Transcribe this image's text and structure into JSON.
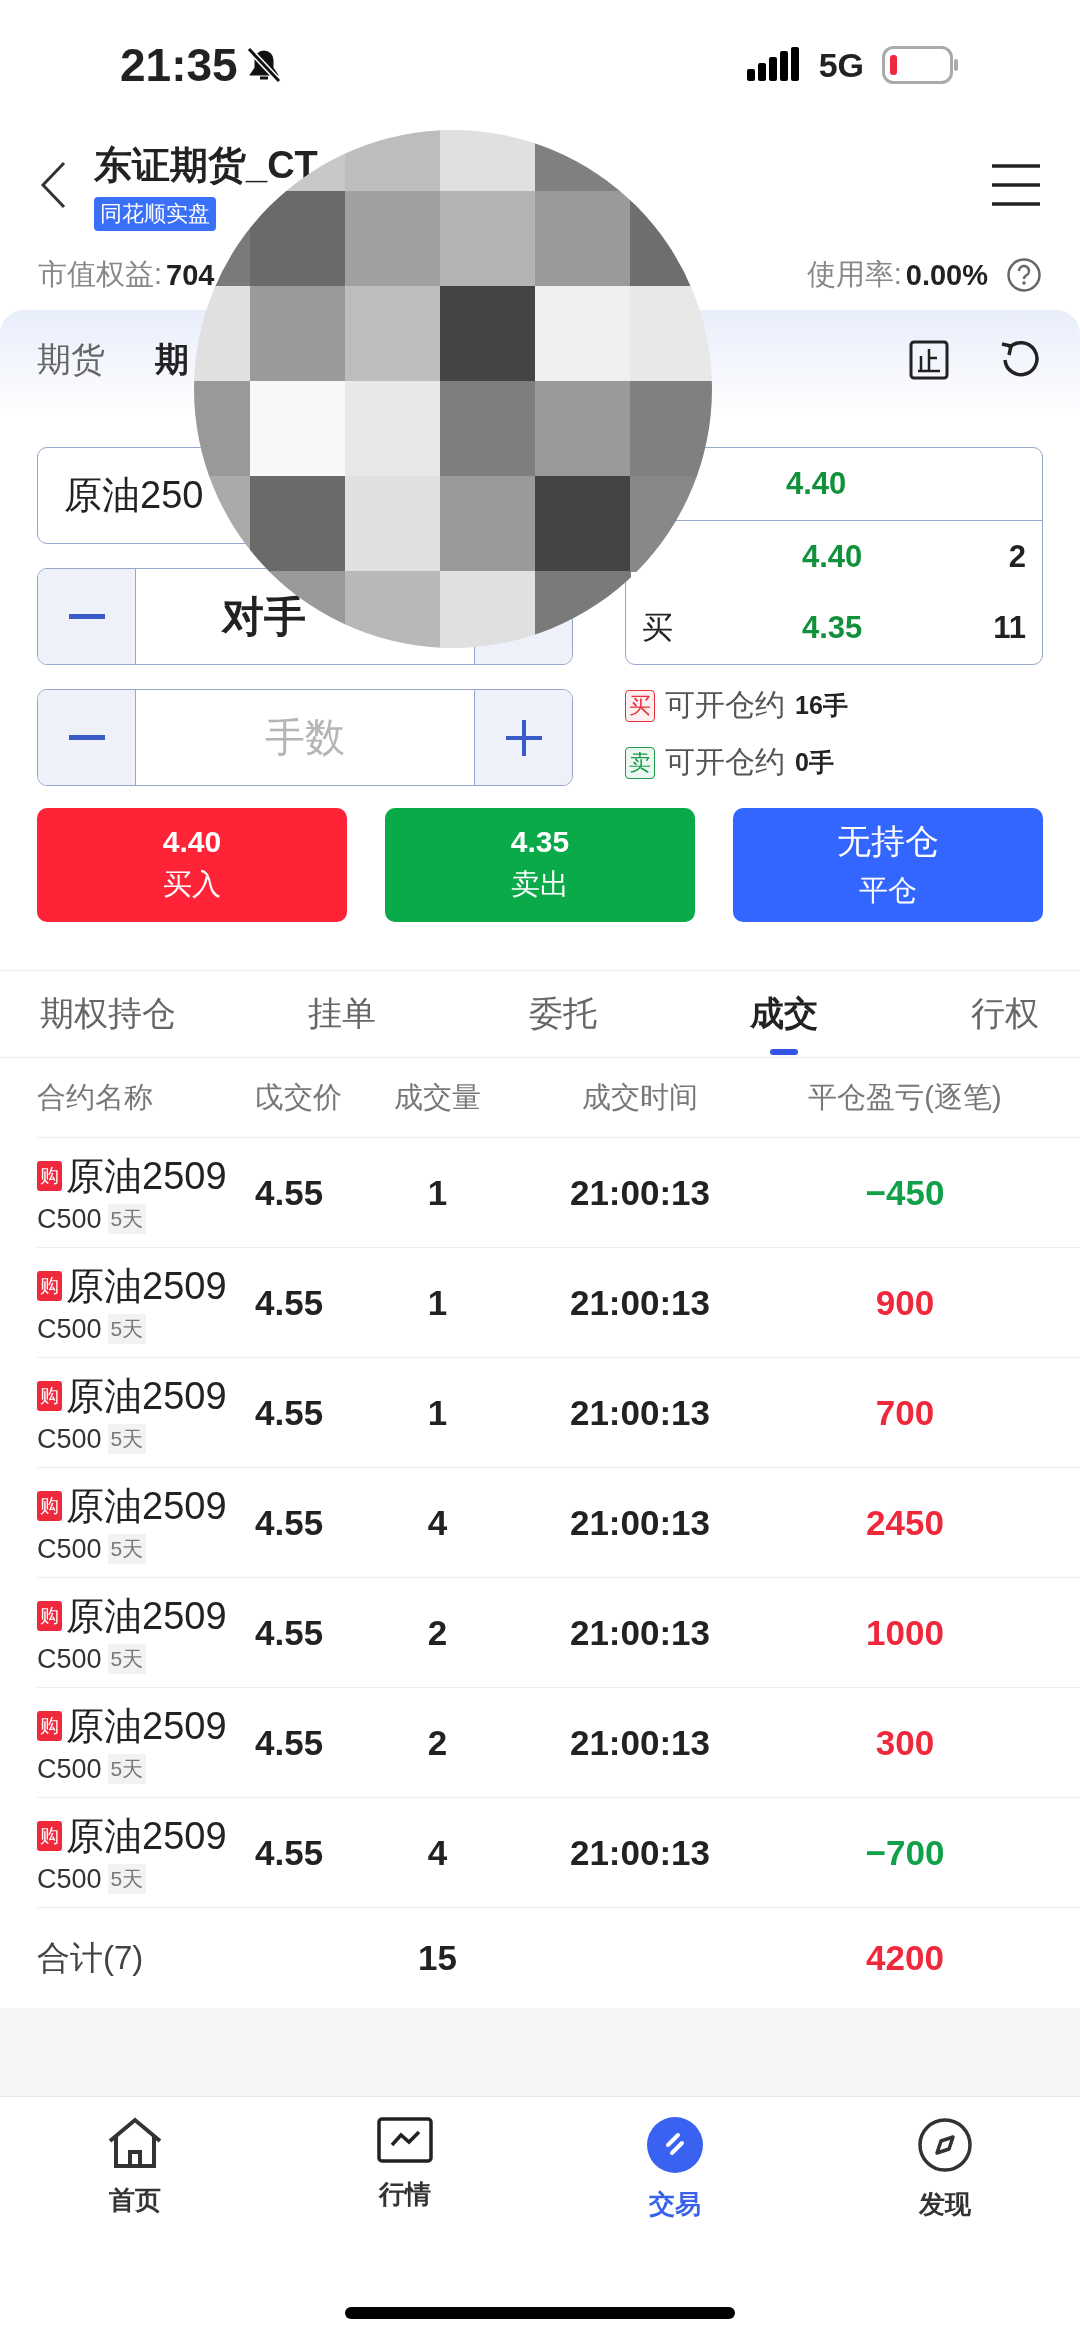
{
  "status_bar": {
    "time": "21:35",
    "network": "5G"
  },
  "header": {
    "title": "东证期货_CT",
    "badge": "同花顺实盘"
  },
  "account": {
    "equity_label": "市值权益:",
    "equity_value": "704",
    "usage_label": "使用率:",
    "usage_value": "0.00%"
  },
  "mode_tabs": [
    {
      "label": "期货",
      "selected": false
    },
    {
      "label": "期",
      "selected": true
    }
  ],
  "order_form": {
    "contract": "原油250",
    "steppers": [
      {
        "value": "对手"
      },
      {
        "placeholder": "手数"
      }
    ],
    "quote": {
      "last": "4.40",
      "rows": [
        {
          "price": "4.40",
          "qty": "2"
        },
        {
          "side": "买",
          "price": "4.35",
          "qty": "11"
        }
      ]
    },
    "availability": [
      {
        "side": "买",
        "label": "可开仓约",
        "amount": "16手",
        "color": "#e8303f"
      },
      {
        "side": "卖",
        "label": "可开仓约",
        "amount": "0手",
        "color": "#1a9a48"
      }
    ],
    "actions": [
      {
        "kind": "trade",
        "price": "4.40",
        "label": "买入",
        "color": "#ff2338"
      },
      {
        "kind": "trade",
        "price": "4.35",
        "label": "卖出",
        "color": "#09aa47"
      },
      {
        "kind": "close",
        "price": "无持仓",
        "label": "平仓",
        "color": "#3366ff"
      }
    ]
  },
  "list_tabs": [
    {
      "label": "期权持仓",
      "selected": false
    },
    {
      "label": "挂单",
      "selected": false
    },
    {
      "label": "委托",
      "selected": false
    },
    {
      "label": "成交",
      "selected": true
    },
    {
      "label": "行权",
      "selected": false
    }
  ],
  "table": {
    "columns": [
      "合约名称",
      "戉交价",
      "成交量",
      "成交时间",
      "平仓盈亏(逐笔)"
    ],
    "rows": [
      {
        "tag": "购",
        "name": "原油2509",
        "strike": "C500",
        "days": "5天",
        "price": "4.55",
        "qty": "1",
        "time": "21:00:13",
        "pnl": "−450",
        "color": "#12a04a"
      },
      {
        "tag": "购",
        "name": "原油2509",
        "strike": "C500",
        "days": "5天",
        "price": "4.55",
        "qty": "1",
        "time": "21:00:13",
        "pnl": "900",
        "color": "#f0283c"
      },
      {
        "tag": "购",
        "name": "原油2509",
        "strike": "C500",
        "days": "5天",
        "price": "4.55",
        "qty": "1",
        "time": "21:00:13",
        "pnl": "700",
        "color": "#f0283c"
      },
      {
        "tag": "购",
        "name": "原油2509",
        "strike": "C500",
        "days": "5天",
        "price": "4.55",
        "qty": "4",
        "time": "21:00:13",
        "pnl": "2450",
        "color": "#f0283c"
      },
      {
        "tag": "购",
        "name": "原油2509",
        "strike": "C500",
        "days": "5天",
        "price": "4.55",
        "qty": "2",
        "time": "21:00:13",
        "pnl": "1000",
        "color": "#f0283c"
      },
      {
        "tag": "购",
        "name": "原油2509",
        "strike": "C500",
        "days": "5天",
        "price": "4.55",
        "qty": "2",
        "time": "21:00:13",
        "pnl": "300",
        "color": "#f0283c"
      },
      {
        "tag": "购",
        "name": "原油2509",
        "strike": "C500",
        "days": "5天",
        "price": "4.55",
        "qty": "4",
        "time": "21:00:13",
        "pnl": "−700",
        "color": "#12a04a"
      }
    ],
    "total": {
      "label": "合计(7)",
      "qty": "15",
      "pnl": "4200",
      "color": "#f0283c"
    }
  },
  "nav": [
    {
      "label": "首页",
      "selected": false
    },
    {
      "label": "行情",
      "selected": false
    },
    {
      "label": "交易",
      "selected": true
    },
    {
      "label": "发现",
      "selected": false
    }
  ]
}
